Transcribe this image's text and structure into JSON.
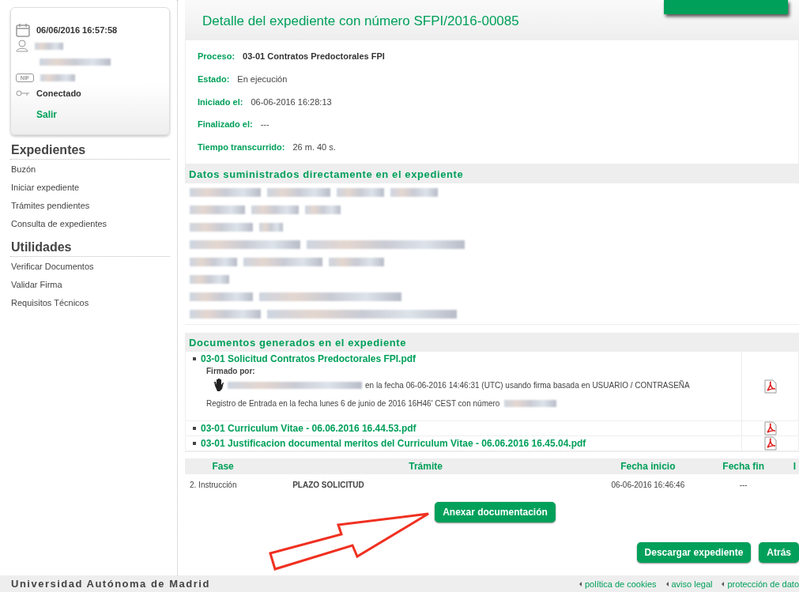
{
  "session": {
    "datetime": "06/06/2016 16:57:58",
    "id_badge": "NIF",
    "status": "Conectado",
    "logout": "Salir"
  },
  "menu": [
    {
      "heading": "Expedientes",
      "items": [
        "Buzón",
        "Iniciar expediente",
        "Trámites pendientes",
        "Consulta de expedientes"
      ]
    },
    {
      "heading": "Utilidades",
      "items": [
        "Verificar Documentos",
        "Validar Firma",
        "Requisitos Técnicos"
      ]
    }
  ],
  "title": "Detalle del expediente con número SFPI/2016-00085",
  "fields": [
    {
      "label": "Proceso:",
      "value": "03-01 Contratos Predoctorales FPI",
      "kind": "bold"
    },
    {
      "label": "Estado:",
      "value": "En ejecución",
      "kind": "plain"
    },
    {
      "label": "Iniciado el:",
      "value": "06-06-2016 16:28:13",
      "kind": "plain"
    },
    {
      "label": "Finalizado el:",
      "value": "---",
      "kind": "plain"
    },
    {
      "label": "Tiempo transcurrido:",
      "value": "26 m. 40 s.",
      "kind": "plain"
    }
  ],
  "supplied_section": {
    "title": "Datos suministrados directamente en el expediente"
  },
  "documents_section": {
    "title": "Documentos generados en el expediente",
    "documents": [
      {
        "name": "03-01 Solicitud Contratos Predoctorales FPI.pdf",
        "signed_label": "Firmado por:",
        "signature": "en la fecha 06-06-2016 14:46:31 (UTC) usando firma basada en USUARIO / CONTRASEÑA",
        "registry": "Registro de Entrada en la fecha lunes 6 de junio de 2016 16H46' CEST con número"
      },
      {
        "name": "03-01 Curriculum Vitae - 06.06.2016 16.44.53.pdf"
      },
      {
        "name": "03-01 Justificacion documental meritos del Curriculum Vitae - 06.06.2016 16.45.04.pdf"
      }
    ]
  },
  "phases": {
    "columns": [
      "Fase",
      "Trámite",
      "Fecha inicio",
      "Fecha fin",
      "I"
    ],
    "rows": [
      [
        "2. Instrucción",
        "PLAZO SOLICITUD",
        "06-06-2016 16:46:46",
        "---"
      ]
    ]
  },
  "attach_button": "Anexar documentación",
  "buttons": [
    "Descargar expediente",
    "Atrás"
  ],
  "footer": {
    "institution": "Universidad Autónoma de Madrid",
    "links": [
      "política de cookies",
      "aviso legal",
      "protección de dato"
    ]
  }
}
